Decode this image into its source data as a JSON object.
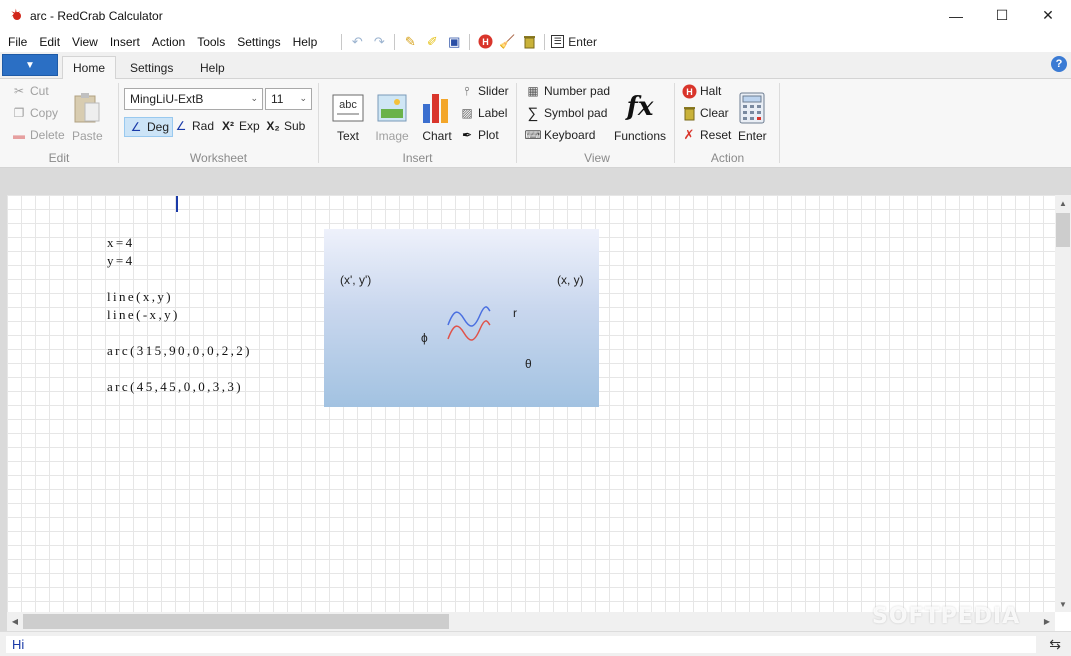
{
  "window": {
    "title": "arc - RedCrab Calculator",
    "minimize": "—",
    "maximize": "☐",
    "close": "✕"
  },
  "menu": [
    "File",
    "Edit",
    "View",
    "Insert",
    "Action",
    "Tools",
    "Settings",
    "Help"
  ],
  "quick_access": {
    "enter_label": "Enter"
  },
  "ribbon_tabs": [
    "Home",
    "Settings",
    "Help"
  ],
  "ribbon": {
    "edit": {
      "label": "Edit",
      "cut": "Cut",
      "copy": "Copy",
      "delete": "Delete",
      "paste": "Paste"
    },
    "worksheet": {
      "label": "Worksheet",
      "font": "MingLiU-ExtB",
      "size": "11",
      "deg": "Deg",
      "rad": "Rad",
      "exp": "Exp",
      "sub": "Sub"
    },
    "insert": {
      "label": "Insert",
      "text": "Text",
      "image": "Image",
      "chart": "Chart",
      "slider": "Slider",
      "label_btn": "Label",
      "plot": "Plot"
    },
    "view": {
      "label": "View",
      "number_pad": "Number pad",
      "symbol_pad": "Symbol pad",
      "keyboard": "Keyboard",
      "functions": "Functions"
    },
    "action": {
      "label": "Action",
      "halt": "Halt",
      "clear": "Clear",
      "reset": "Reset",
      "enter": "Enter"
    }
  },
  "worksheet_code": "x=4\ny=4\n\nline(x,y)\nline(-x,y)\n\narc(315,90,0,0,2,2)\n\narc(45,45,0,0,3,3)",
  "plot_labels": {
    "tl": "(x', y')",
    "tr": "(x, y)",
    "r": "r",
    "phi": "ϕ",
    "theta": "θ"
  },
  "status": {
    "input": "Hi"
  },
  "watermark": "SOFTPEDIA",
  "icons": {
    "cut": "scissors-icon",
    "copy": "copy-icon",
    "delete": "delete-icon",
    "paste": "paste-icon",
    "text": "text-icon",
    "image": "image-icon",
    "chart": "chart-icon",
    "functions": "fx-icon",
    "halt": "halt-icon",
    "clear": "trash-icon",
    "reset": "reset-icon",
    "enter": "calculator-icon"
  },
  "colors": {
    "accent": "#2b6fc4",
    "sheet_grid": "#e6e6e6",
    "plot_top": "#eef1fb",
    "plot_bottom": "#a2c2e1"
  }
}
